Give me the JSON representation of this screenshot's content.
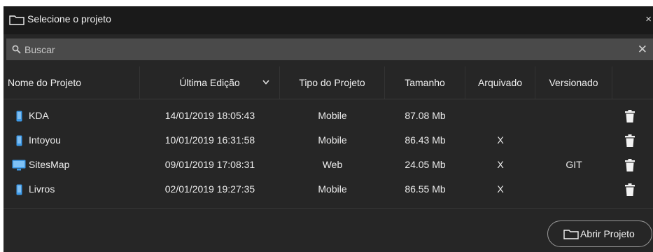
{
  "dialog": {
    "title": "Selecione o projeto",
    "title_icon": "folder-icon",
    "close_glyph": "×"
  },
  "search": {
    "placeholder": "Buscar",
    "icon": "search-icon",
    "clear_glyph": "✕"
  },
  "table": {
    "columns": [
      "Nome do Projeto",
      "Última Edição",
      "Tipo do Projeto",
      "Tamanho",
      "Arquivado",
      "Versionado"
    ],
    "sorted_by": "Última Edição",
    "rows": [
      {
        "name": "KDA",
        "icon": "mobile-icon",
        "last_edit": "14/01/2019 18:05:43",
        "type": "Mobile",
        "size": "87.08 Mb",
        "archived": "",
        "versioned": ""
      },
      {
        "name": "Intoyou",
        "icon": "mobile-icon",
        "last_edit": "10/01/2019 16:31:58",
        "type": "Mobile",
        "size": "86.43 Mb",
        "archived": "X",
        "versioned": ""
      },
      {
        "name": "SitesMap",
        "icon": "monitor-icon",
        "last_edit": "09/01/2019 17:08:31",
        "type": "Web",
        "size": "24.05 Mb",
        "archived": "X",
        "versioned": "GIT"
      },
      {
        "name": "Livros",
        "icon": "mobile-icon",
        "last_edit": "02/01/2019 19:27:35",
        "type": "Mobile",
        "size": "86.55 Mb",
        "archived": "X",
        "versioned": ""
      }
    ]
  },
  "footer": {
    "open_button_label": "Abrir Projeto",
    "open_button_icon": "folder-icon"
  },
  "colors": {
    "dialog_bg": "#262626",
    "titlebar_bg": "#1a1a1a",
    "search_bg": "#4a4a4a",
    "icon_blue": "#3d9be9",
    "text": "#ececec"
  }
}
